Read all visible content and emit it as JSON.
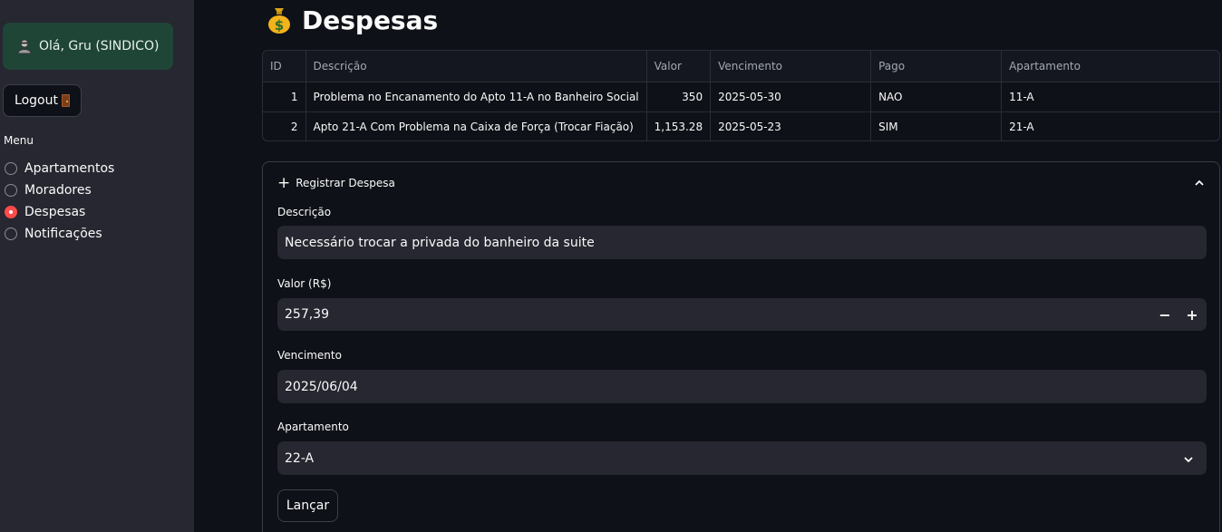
{
  "sidebar": {
    "greeting": "Olá, Gru (SINDICO)",
    "logout_label": "Logout",
    "menu_label": "Menu",
    "menu_items": [
      {
        "label": "Apartamentos",
        "selected": false
      },
      {
        "label": "Moradores",
        "selected": false
      },
      {
        "label": "Despesas",
        "selected": true
      },
      {
        "label": "Notificações",
        "selected": false
      }
    ]
  },
  "page": {
    "title": "Despesas"
  },
  "table": {
    "columns": [
      "ID",
      "Descrição",
      "Valor",
      "Vencimento",
      "Pago",
      "Apartamento"
    ],
    "rows": [
      [
        "1",
        "Problema no Encanamento do Apto 11-A no Banheiro Social",
        "350",
        "2025-05-30",
        "NAO",
        "11-A"
      ],
      [
        "2",
        "Apto 21-A Com Problema na Caixa de Força (Trocar Fiação)",
        "1,153.28",
        "2025-05-23",
        "SIM",
        "21-A"
      ]
    ]
  },
  "form": {
    "expander_label": "Registrar Despesa",
    "descricao_label": "Descrição",
    "descricao_value": "Necessário trocar a privada do banheiro da suite",
    "valor_label": "Valor (R$)",
    "valor_value": "257,39",
    "minus": "−",
    "plus": "+",
    "vencimento_label": "Vencimento",
    "vencimento_value": "2025/06/04",
    "apartamento_label": "Apartamento",
    "apartamento_value": "22-A",
    "submit_label": "Lançar"
  },
  "colors": {
    "accent": "#ff4b4b",
    "user_box": "#1f4537",
    "background": "#0e1117",
    "sidebar": "#262730"
  }
}
